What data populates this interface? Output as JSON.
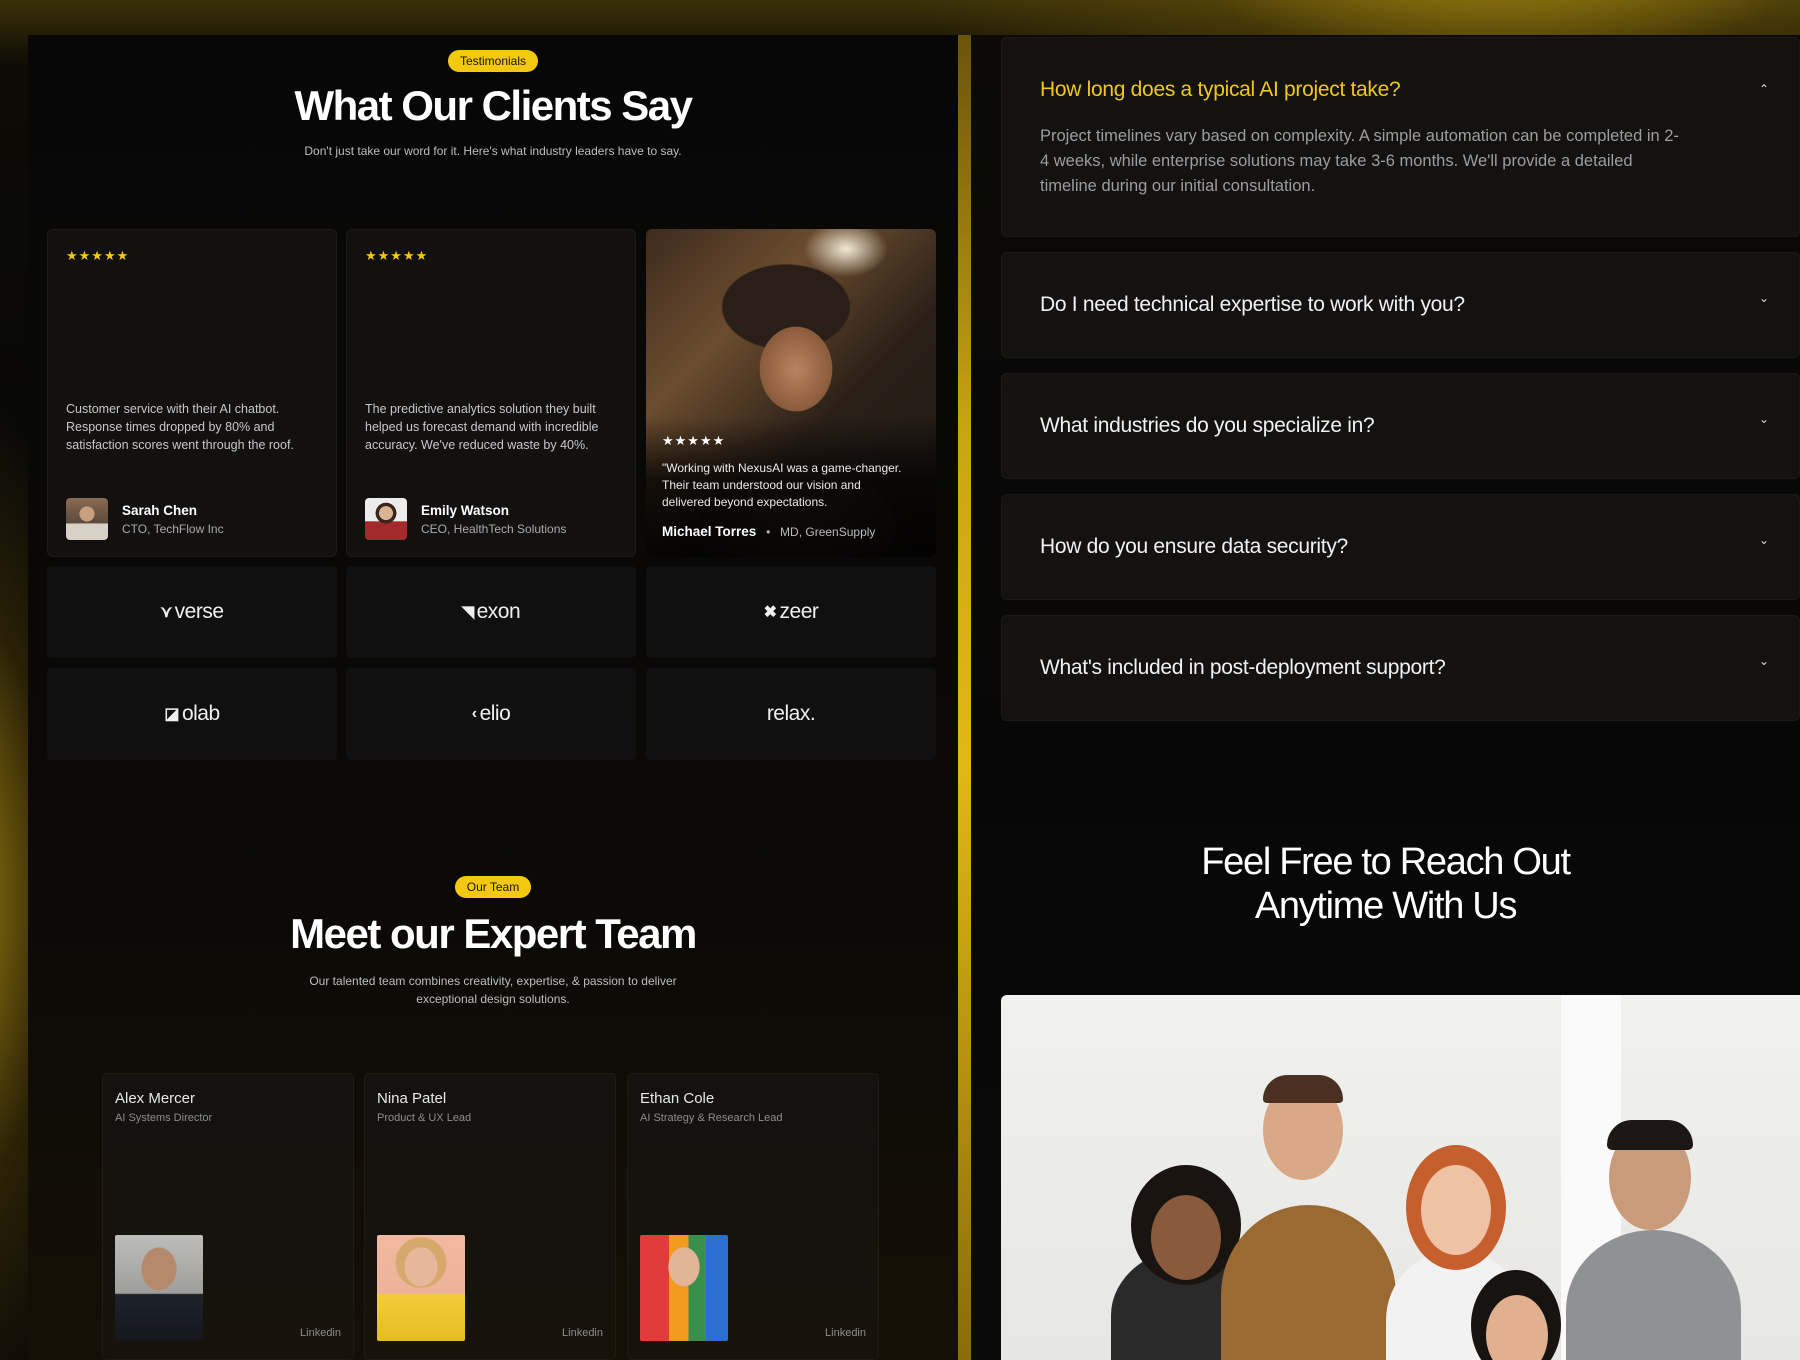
{
  "testimonials": {
    "badge": "Testimonials",
    "title": "What Our Clients Say",
    "subtitle": "Don't just take our word for it. Here's what industry leaders have to say.",
    "cards": [
      {
        "stars": "★★★★★",
        "quote": "Customer service with their AI chatbot. Response times dropped by 80% and satisfaction scores went through the roof.",
        "name": "Sarah Chen",
        "role": "CTO, TechFlow Inc"
      },
      {
        "stars": "★★★★★",
        "quote": "The predictive analytics solution they built helped us forecast demand with incredible accuracy. We've reduced waste by 40%.",
        "name": "Emily Watson",
        "role": "CEO, HealthTech Solutions"
      }
    ],
    "featured": {
      "stars": "★★★★★",
      "quote": "\"Working with NexusAI was a game-changer. Their team understood our vision and delivered beyond expectations.",
      "name": "Michael Torres",
      "separator": "•",
      "role": "MD, GreenSupply"
    }
  },
  "logos": [
    {
      "mark": "⋎",
      "name": "verse"
    },
    {
      "mark": "◥",
      "name": "exon"
    },
    {
      "mark": "✖",
      "name": "zeer"
    },
    {
      "mark": "◪",
      "name": "olab"
    },
    {
      "mark": "‹",
      "name": "elio"
    },
    {
      "mark": "",
      "name": "relax."
    }
  ],
  "team": {
    "badge": "Our Team",
    "title": "Meet our Expert Team",
    "subtitle_line1": "Our talented team combines creativity, expertise, & passion to deliver",
    "subtitle_line2": "exceptional design solutions.",
    "members": [
      {
        "name": "Alex Mercer",
        "role": "AI Systems Director",
        "link": "Linkedin"
      },
      {
        "name": "Nina Patel",
        "role": "Product & UX Lead",
        "link": "Linkedin"
      },
      {
        "name": "Ethan Cole",
        "role": "AI Strategy & Research Lead",
        "link": "Linkedin"
      }
    ]
  },
  "faq": {
    "items": [
      {
        "question": "How long does a typical AI project take?",
        "answer": "Project timelines vary based on complexity. A simple automation can be completed in 2-4 weeks, while enterprise solutions may take 3-6 months. We'll provide a detailed timeline during our initial consultation.",
        "open": true
      },
      {
        "question": "Do I need technical expertise to work with you?",
        "open": false
      },
      {
        "question": "What industries do you specialize in?",
        "open": false
      },
      {
        "question": "How do you ensure data security?",
        "open": false
      },
      {
        "question": "What's included in post-deployment support?",
        "open": false
      }
    ],
    "chevron_open": "⌃",
    "chevron_closed": "⌄"
  },
  "contact": {
    "title_line1": "Feel Free to Reach Out",
    "title_line2": "Anytime With Us"
  },
  "colors": {
    "accent": "#f2c811",
    "background": "#070707",
    "card": "#121110"
  }
}
